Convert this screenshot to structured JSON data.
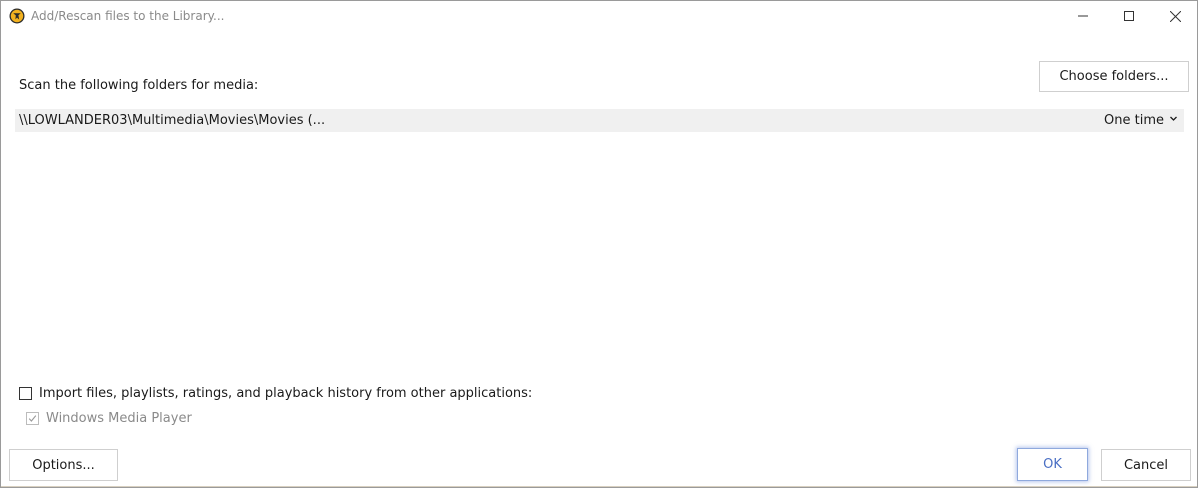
{
  "window": {
    "title": "Add/Rescan files to the Library..."
  },
  "scan": {
    "label": "Scan the following folders for media:",
    "choose_label": "Choose folders..."
  },
  "folders": [
    {
      "path": "\\\\LOWLANDER03\\Multimedia\\Movies\\Movies (...",
      "frequency": "One time"
    }
  ],
  "import": {
    "label": "Import files, playlists, ratings, and playback history from other applications:",
    "checked": false,
    "sources": [
      {
        "label": "Windows Media Player",
        "checked": true,
        "disabled": true
      }
    ]
  },
  "buttons": {
    "options_label": "Options...",
    "ok_label": "OK",
    "cancel_label": "Cancel"
  },
  "icons": {
    "app": "app-logo-icon",
    "minimize": "minimize-icon",
    "maximize": "maximize-icon",
    "close": "close-icon",
    "dropdown": "chevron-down-icon",
    "check": "checkmark-icon"
  },
  "colors": {
    "accent": "#4a6fc4",
    "list_background": "#f0f0f0",
    "title_text": "#8a8a8a"
  }
}
